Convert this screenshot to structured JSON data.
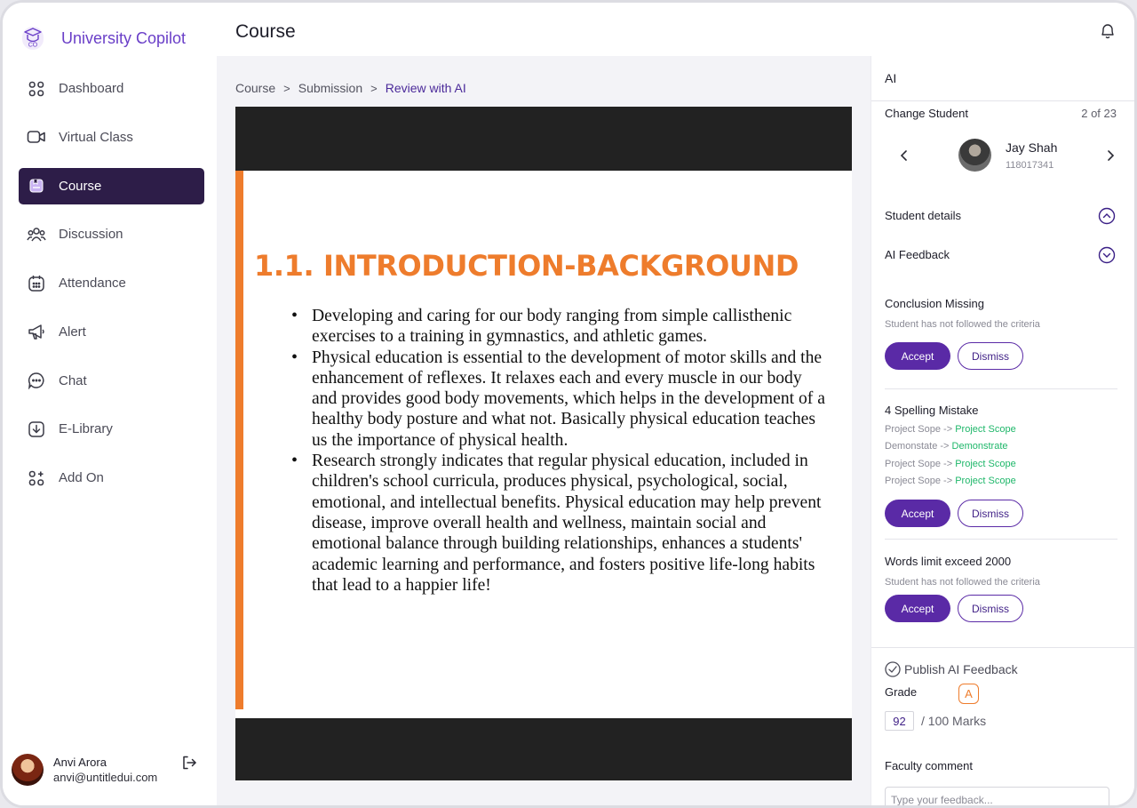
{
  "brand": {
    "name": "University Copilot",
    "logo_icon": "mortarboard-co-icon"
  },
  "sidebar": {
    "items": [
      {
        "label": "Dashboard",
        "icon": "grid-icon",
        "active": false
      },
      {
        "label": "Virtual Class",
        "icon": "video-camera-icon",
        "active": false
      },
      {
        "label": "Course",
        "icon": "book-icon",
        "active": true
      },
      {
        "label": "Discussion",
        "icon": "users-icon",
        "active": false
      },
      {
        "label": "Attendance",
        "icon": "calendar-icon",
        "active": false
      },
      {
        "label": "Alert",
        "icon": "megaphone-icon",
        "active": false
      },
      {
        "label": "Chat",
        "icon": "chat-bubble-icon",
        "active": false
      },
      {
        "label": "E-Library",
        "icon": "download-box-icon",
        "active": false
      },
      {
        "label": "Add On",
        "icon": "add-grid-icon",
        "active": false
      }
    ]
  },
  "user": {
    "name": "Anvi Arora",
    "email": "anvi@untitledui.com"
  },
  "header": {
    "title": "Course"
  },
  "breadcrumb": {
    "items": [
      "Course",
      "Submission",
      "Review with AI"
    ]
  },
  "document": {
    "heading": "1.1. INTRODUCTION-BACKGROUND",
    "bullets": [
      "Developing and caring for our body ranging from simple callisthenic exercises to a training in gymnastics, and athletic games.",
      "Physical education is essential to the development of motor skills and the enhancement of reflexes. It relaxes each and every muscle in our body and provides good body movements, which helps in the development of a healthy body posture and what not. Basically physical education teaches us the importance of physical health.",
      "Research strongly indicates that regular physical education, included in children's school curricula, produces physical, psychological, social, emotional, and intellectual benefits. Physical education may help prevent disease, improve overall health and wellness, maintain social and emotional balance through building relationships, enhances a students' academic learning and performance, and fosters positive life-long habits that lead to a happier life!"
    ]
  },
  "ai_panel": {
    "title": "AI",
    "change_student_label": "Change Student",
    "student_count": "2 of 23",
    "student": {
      "name": "Jay Shah",
      "id": "118017341"
    },
    "student_details_label": "Student details",
    "ai_feedback_label": "AI Feedback",
    "feedback": [
      {
        "title": "Conclusion Missing",
        "subtitle": "Student has not followed the criteria",
        "accept": "Accept",
        "dismiss": "Dismiss"
      },
      {
        "title": "4 Spelling Mistake",
        "corrections": [
          {
            "wrong": "Project Sope",
            "arrow": "->",
            "right": "Project Scope"
          },
          {
            "wrong": "Demonstate",
            "arrow": "->",
            "right": "Demonstrate"
          },
          {
            "wrong": "Project Sope",
            "arrow": "->",
            "right": "Project Scope"
          },
          {
            "wrong": "Project Sope",
            "arrow": "->",
            "right": "Project Scope"
          }
        ],
        "accept": "Accept",
        "dismiss": "Dismiss"
      },
      {
        "title": "Words limit exceed 2000",
        "subtitle": "Student has not followed the criteria",
        "accept": "Accept",
        "dismiss": "Dismiss"
      }
    ],
    "publish_label": "Publish AI Feedback",
    "grade_label": "Grade",
    "grade": "A",
    "marks_value": "92",
    "marks_total": "/  100 Marks",
    "faculty_comment_label": "Faculty comment",
    "faculty_comment_placeholder": "Type your feedback..."
  },
  "colors": {
    "brand_purple": "#6a3fc8",
    "active_nav": "#2d1d48",
    "accept_button": "#5a2aa6",
    "doc_accent": "#ee7c2c",
    "correction_green": "#1fb76a"
  }
}
